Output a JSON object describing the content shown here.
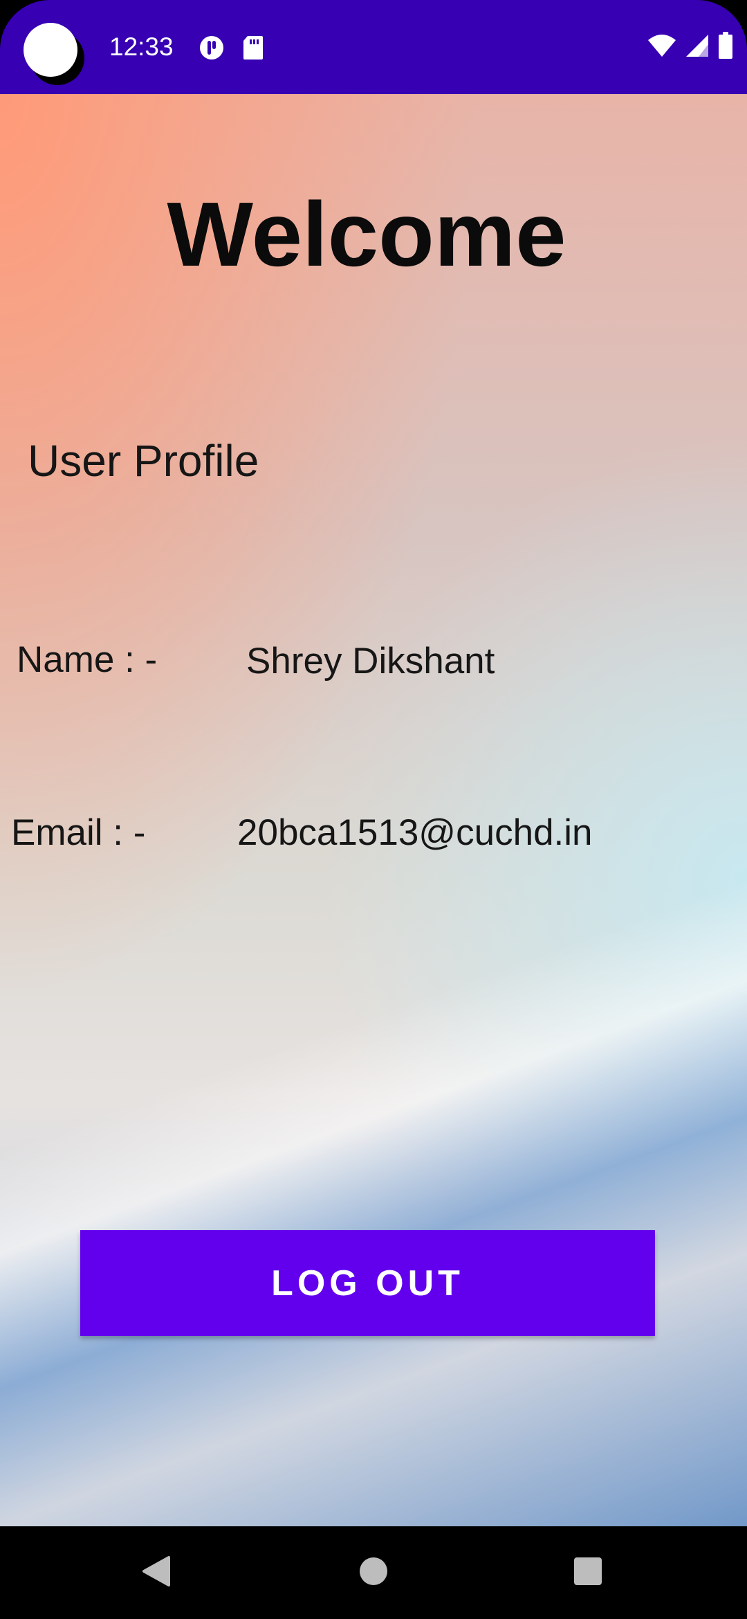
{
  "status_bar": {
    "time": "12:33",
    "background_color": "#3700b3",
    "icons_left": [
      "camera-cutout",
      "data-saver-icon",
      "sd-card-icon"
    ],
    "icons_right": [
      "wifi-icon",
      "signal-icon",
      "battery-icon"
    ]
  },
  "main": {
    "title": "Welcome",
    "section_heading": "User Profile",
    "name_label": "Name : -",
    "name_value": "Shrey Dikshant",
    "email_label": "Email : -",
    "email_value": "20bca1513@cuchd.in",
    "logout_label": "LOG OUT",
    "accent_color": "#6200ee"
  },
  "nav_bar": {
    "items": [
      "back-icon",
      "home-icon",
      "recents-icon"
    ]
  }
}
